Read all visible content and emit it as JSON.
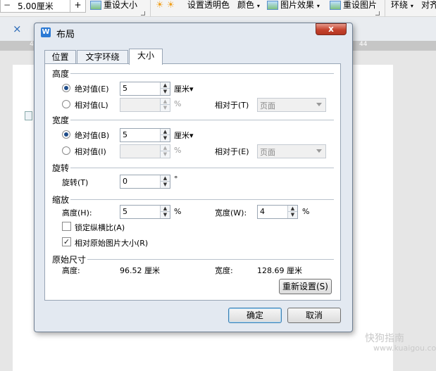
{
  "ribbon": {
    "size_value": "5.00厘米",
    "minus": "−",
    "plus": "+",
    "reset_size_label": "重设大小",
    "set_transparent_label": "设置透明色",
    "color_label": "颜色",
    "picture_effect_label": "图片效果",
    "reset_picture_label": "重设图片",
    "wrap_label": "环绕",
    "align_label": "对齐"
  },
  "tabbar": {
    "close_glyph": "×"
  },
  "ruler": {
    "left_label": "4",
    "right_label": "44"
  },
  "watermark": {
    "brand": "快狗指南",
    "url": "www.kuaigou.com"
  },
  "dialog": {
    "title": "布局",
    "close_glyph": "x",
    "tabs": [
      {
        "label": "位置",
        "active": false
      },
      {
        "label": "文字环绕",
        "active": false
      },
      {
        "label": "大小",
        "active": true
      }
    ],
    "height_section": {
      "title": "高度",
      "absolute_label": "绝对值(E)",
      "absolute_value": "5",
      "absolute_unit": "厘米▾",
      "relative_label": "相对值(L)",
      "relative_value": "",
      "relative_unit": "%",
      "relative_to_label": "相对于(T)",
      "relative_to_value": "页面"
    },
    "width_section": {
      "title": "宽度",
      "absolute_label": "绝对值(B)",
      "absolute_value": "5",
      "absolute_unit": "厘米▾",
      "relative_label": "相对值(I)",
      "relative_value": "",
      "relative_unit": "%",
      "relative_to_label": "相对于(E)",
      "relative_to_value": "页面"
    },
    "rotation_section": {
      "title": "旋转",
      "rotation_label": "旋转(T)",
      "rotation_value": "0",
      "rotation_unit": "°"
    },
    "scale_section": {
      "title": "缩放",
      "height_label": "高度(H):",
      "height_value": "5",
      "height_unit": "%",
      "width_label": "宽度(W):",
      "width_value": "4",
      "width_unit": "%",
      "lock_ratio_label": "锁定纵横比(A)",
      "lock_ratio_checked": false,
      "relative_original_label": "相对原始图片大小(R)",
      "relative_original_checked": true
    },
    "original_section": {
      "title": "原始尺寸",
      "height_label": "高度:",
      "height_value": "96.52 厘米",
      "width_label": "宽度:",
      "width_value": "128.69 厘米",
      "reset_label": "重新设置(S)"
    },
    "ok_label": "确定",
    "cancel_label": "取消"
  }
}
